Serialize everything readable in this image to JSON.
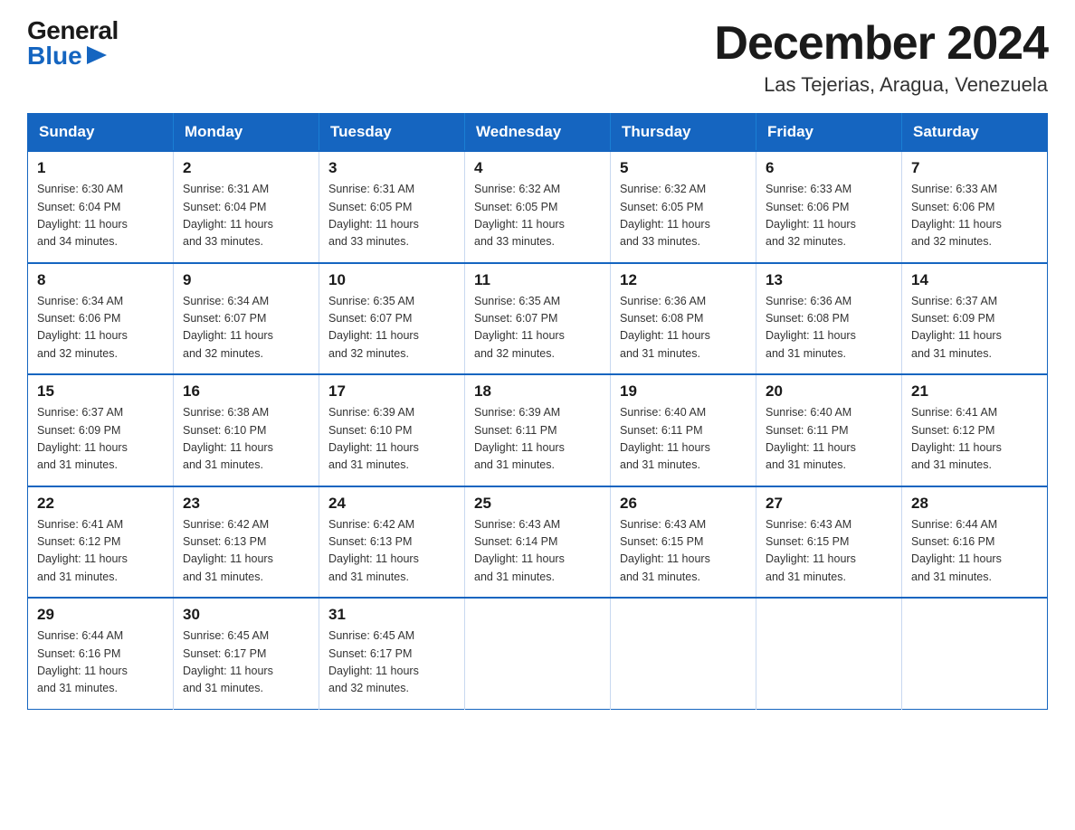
{
  "logo": {
    "general": "General",
    "blue": "Blue",
    "triangle": "▶"
  },
  "title": "December 2024",
  "subtitle": "Las Tejerias, Aragua, Venezuela",
  "days_of_week": [
    "Sunday",
    "Monday",
    "Tuesday",
    "Wednesday",
    "Thursday",
    "Friday",
    "Saturday"
  ],
  "weeks": [
    [
      {
        "day": "1",
        "sunrise": "6:30 AM",
        "sunset": "6:04 PM",
        "daylight": "11 hours and 34 minutes."
      },
      {
        "day": "2",
        "sunrise": "6:31 AM",
        "sunset": "6:04 PM",
        "daylight": "11 hours and 33 minutes."
      },
      {
        "day": "3",
        "sunrise": "6:31 AM",
        "sunset": "6:05 PM",
        "daylight": "11 hours and 33 minutes."
      },
      {
        "day": "4",
        "sunrise": "6:32 AM",
        "sunset": "6:05 PM",
        "daylight": "11 hours and 33 minutes."
      },
      {
        "day": "5",
        "sunrise": "6:32 AM",
        "sunset": "6:05 PM",
        "daylight": "11 hours and 33 minutes."
      },
      {
        "day": "6",
        "sunrise": "6:33 AM",
        "sunset": "6:06 PM",
        "daylight": "11 hours and 32 minutes."
      },
      {
        "day": "7",
        "sunrise": "6:33 AM",
        "sunset": "6:06 PM",
        "daylight": "11 hours and 32 minutes."
      }
    ],
    [
      {
        "day": "8",
        "sunrise": "6:34 AM",
        "sunset": "6:06 PM",
        "daylight": "11 hours and 32 minutes."
      },
      {
        "day": "9",
        "sunrise": "6:34 AM",
        "sunset": "6:07 PM",
        "daylight": "11 hours and 32 minutes."
      },
      {
        "day": "10",
        "sunrise": "6:35 AM",
        "sunset": "6:07 PM",
        "daylight": "11 hours and 32 minutes."
      },
      {
        "day": "11",
        "sunrise": "6:35 AM",
        "sunset": "6:07 PM",
        "daylight": "11 hours and 32 minutes."
      },
      {
        "day": "12",
        "sunrise": "6:36 AM",
        "sunset": "6:08 PM",
        "daylight": "11 hours and 31 minutes."
      },
      {
        "day": "13",
        "sunrise": "6:36 AM",
        "sunset": "6:08 PM",
        "daylight": "11 hours and 31 minutes."
      },
      {
        "day": "14",
        "sunrise": "6:37 AM",
        "sunset": "6:09 PM",
        "daylight": "11 hours and 31 minutes."
      }
    ],
    [
      {
        "day": "15",
        "sunrise": "6:37 AM",
        "sunset": "6:09 PM",
        "daylight": "11 hours and 31 minutes."
      },
      {
        "day": "16",
        "sunrise": "6:38 AM",
        "sunset": "6:10 PM",
        "daylight": "11 hours and 31 minutes."
      },
      {
        "day": "17",
        "sunrise": "6:39 AM",
        "sunset": "6:10 PM",
        "daylight": "11 hours and 31 minutes."
      },
      {
        "day": "18",
        "sunrise": "6:39 AM",
        "sunset": "6:11 PM",
        "daylight": "11 hours and 31 minutes."
      },
      {
        "day": "19",
        "sunrise": "6:40 AM",
        "sunset": "6:11 PM",
        "daylight": "11 hours and 31 minutes."
      },
      {
        "day": "20",
        "sunrise": "6:40 AM",
        "sunset": "6:11 PM",
        "daylight": "11 hours and 31 minutes."
      },
      {
        "day": "21",
        "sunrise": "6:41 AM",
        "sunset": "6:12 PM",
        "daylight": "11 hours and 31 minutes."
      }
    ],
    [
      {
        "day": "22",
        "sunrise": "6:41 AM",
        "sunset": "6:12 PM",
        "daylight": "11 hours and 31 minutes."
      },
      {
        "day": "23",
        "sunrise": "6:42 AM",
        "sunset": "6:13 PM",
        "daylight": "11 hours and 31 minutes."
      },
      {
        "day": "24",
        "sunrise": "6:42 AM",
        "sunset": "6:13 PM",
        "daylight": "11 hours and 31 minutes."
      },
      {
        "day": "25",
        "sunrise": "6:43 AM",
        "sunset": "6:14 PM",
        "daylight": "11 hours and 31 minutes."
      },
      {
        "day": "26",
        "sunrise": "6:43 AM",
        "sunset": "6:15 PM",
        "daylight": "11 hours and 31 minutes."
      },
      {
        "day": "27",
        "sunrise": "6:43 AM",
        "sunset": "6:15 PM",
        "daylight": "11 hours and 31 minutes."
      },
      {
        "day": "28",
        "sunrise": "6:44 AM",
        "sunset": "6:16 PM",
        "daylight": "11 hours and 31 minutes."
      }
    ],
    [
      {
        "day": "29",
        "sunrise": "6:44 AM",
        "sunset": "6:16 PM",
        "daylight": "11 hours and 31 minutes."
      },
      {
        "day": "30",
        "sunrise": "6:45 AM",
        "sunset": "6:17 PM",
        "daylight": "11 hours and 31 minutes."
      },
      {
        "day": "31",
        "sunrise": "6:45 AM",
        "sunset": "6:17 PM",
        "daylight": "11 hours and 32 minutes."
      },
      null,
      null,
      null,
      null
    ]
  ],
  "labels": {
    "sunrise": "Sunrise:",
    "sunset": "Sunset:",
    "daylight": "Daylight:"
  }
}
